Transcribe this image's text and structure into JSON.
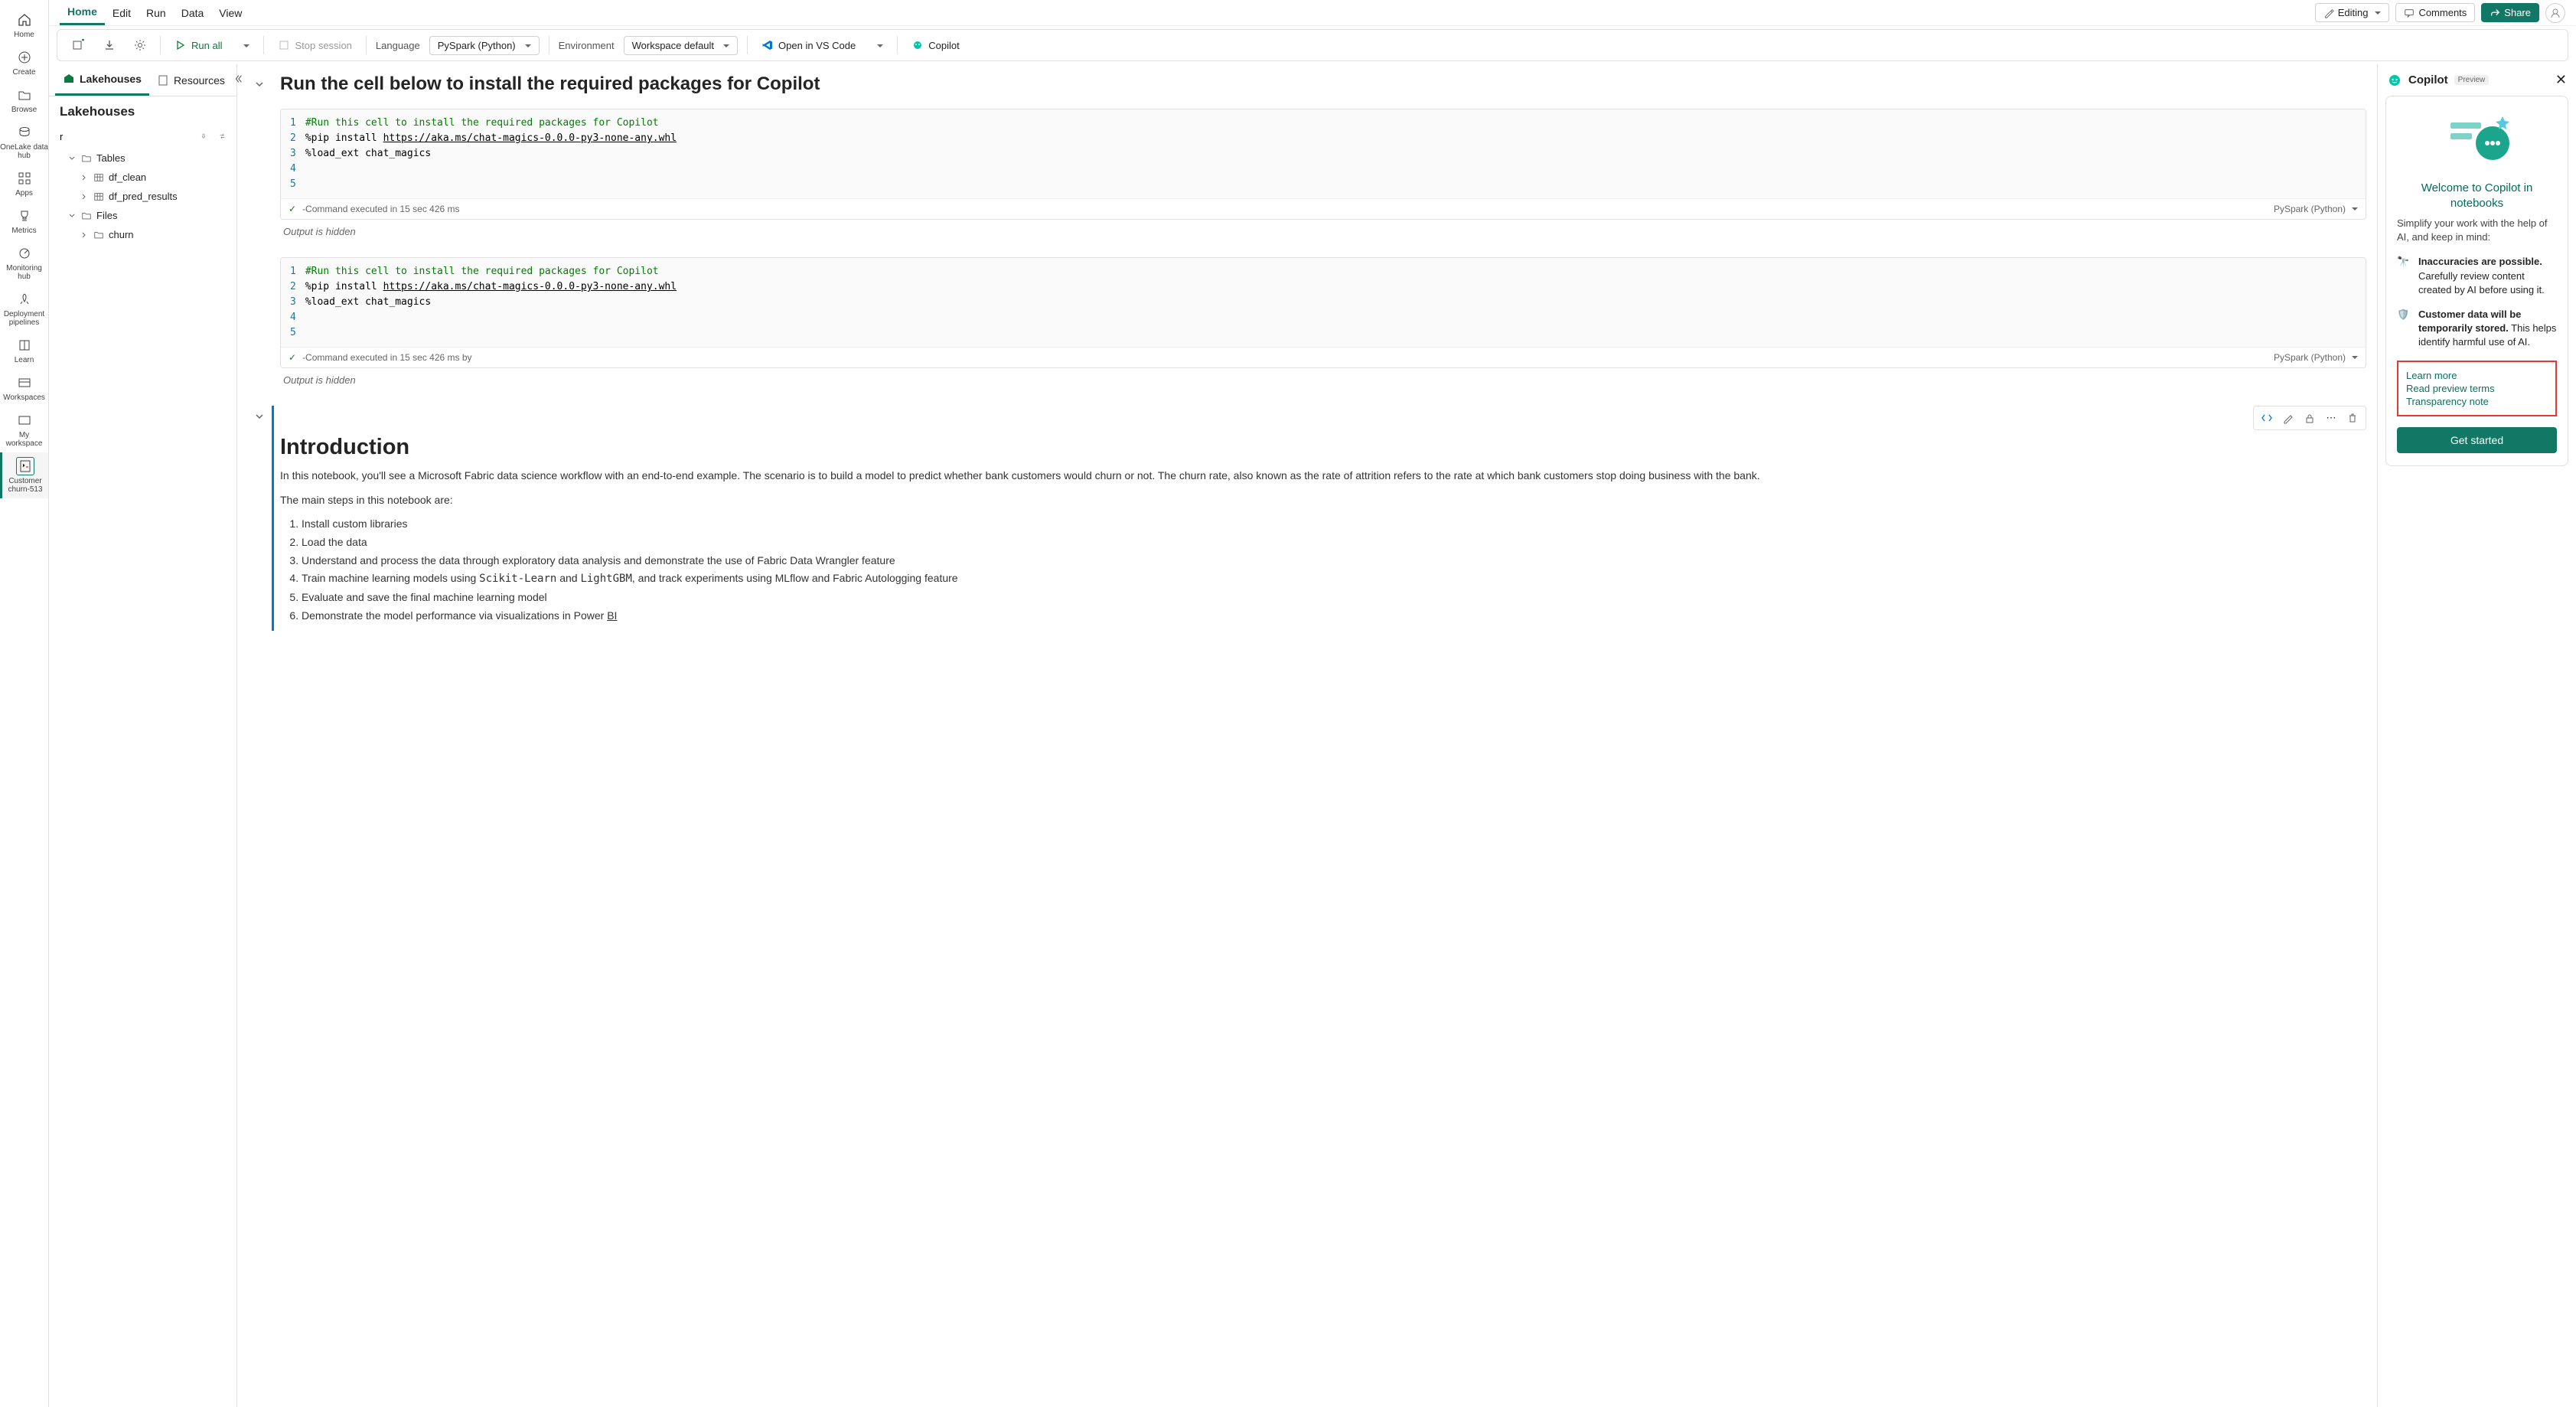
{
  "leftrail": [
    {
      "icon": "home",
      "label": "Home"
    },
    {
      "icon": "plus",
      "label": "Create"
    },
    {
      "icon": "folder",
      "label": "Browse"
    },
    {
      "icon": "hub",
      "label": "OneLake data hub"
    },
    {
      "icon": "apps",
      "label": "Apps"
    },
    {
      "icon": "trophy",
      "label": "Metrics"
    },
    {
      "icon": "monitor",
      "label": "Monitoring hub"
    },
    {
      "icon": "rocket",
      "label": "Deployment pipelines"
    },
    {
      "icon": "book",
      "label": "Learn"
    },
    {
      "icon": "workspace",
      "label": "Workspaces"
    },
    {
      "icon": "myws",
      "label": "My workspace"
    },
    {
      "icon": "nb",
      "label": "Customer churn-513",
      "active": true
    }
  ],
  "topmenu": {
    "items": [
      "Home",
      "Edit",
      "Run",
      "Data",
      "View"
    ],
    "active": 0,
    "editing": "Editing",
    "comments": "Comments",
    "share": "Share"
  },
  "toolbar": {
    "run_all": "Run all",
    "stop_session": "Stop session",
    "language_label": "Language",
    "language_value": "PySpark (Python)",
    "env_label": "Environment",
    "env_value": "Workspace default",
    "vscode": "Open in VS Code",
    "copilot": "Copilot"
  },
  "explorer": {
    "tabs": [
      "Lakehouses",
      "Resources"
    ],
    "title": "Lakehouses",
    "search": "r",
    "tree": {
      "tables_label": "Tables",
      "tables": [
        "df_clean",
        "df_pred_results"
      ],
      "files_label": "Files",
      "files": [
        "churn"
      ]
    }
  },
  "notebook": {
    "h1": "Run the cell below to install the required packages for Copilot",
    "cell1": {
      "lines": [
        {
          "t": "comment",
          "v": "#Run this cell to install the required packages for Copilot"
        },
        {
          "t": "pip",
          "pre": "%pip install ",
          "url": "https://aka.ms/chat-magics-0.0.0-py3-none-any.whl"
        },
        {
          "t": "magic",
          "v": "%load_ext chat_magics"
        },
        {
          "t": "blank",
          "v": ""
        }
      ],
      "status": "-Command executed in 15 sec 426 ms",
      "lang": "PySpark (Python)",
      "output": "Output is hidden"
    },
    "cell2": {
      "lines": [
        {
          "t": "comment",
          "v": "#Run this cell to install the required packages for Copilot"
        },
        {
          "t": "pip",
          "pre": "%pip install ",
          "url": "https://aka.ms/chat-magics-0.0.0-py3-none-any.whl"
        },
        {
          "t": "magic",
          "v": "%load_ext chat_magics"
        },
        {
          "t": "blank",
          "v": ""
        }
      ],
      "status": "-Command executed in 15 sec 426 ms by",
      "lang": "PySpark (Python)",
      "output": "Output is hidden"
    },
    "intro": {
      "heading": "Introduction",
      "p1": "In this notebook, you'll see a Microsoft Fabric data science workflow with an end-to-end example. The scenario is to build a model to predict whether bank customers would churn or not. The churn rate, also known as the rate of attrition refers to the rate at which bank customers stop doing business with the bank.",
      "p2": "The main steps in this notebook are:",
      "steps": [
        "Install custom libraries",
        "Load the data",
        "Understand and process the data through exploratory data analysis and demonstrate the use of Fabric Data Wrangler feature",
        "Train machine learning models using Scikit-Learn and LightGBM, and track experiments using MLflow and Fabric Autologging feature",
        "Evaluate and save the final machine learning model",
        "Demonstrate the model performance via visualizations in Power BI"
      ]
    }
  },
  "copilot": {
    "title": "Copilot",
    "badge": "Preview",
    "welcome": "Welcome to Copilot in notebooks",
    "sub": "Simplify your work with the help of AI, and keep in mind:",
    "note1_b": "Inaccuracies are possible.",
    "note1": "Carefully review content created by AI before using it.",
    "note2_b": "Customer data will be temporarily stored.",
    "note2": "This helps identify harmful use of AI.",
    "links": [
      "Learn more",
      "Read preview terms",
      "Transparency note"
    ],
    "get_started": "Get started"
  }
}
